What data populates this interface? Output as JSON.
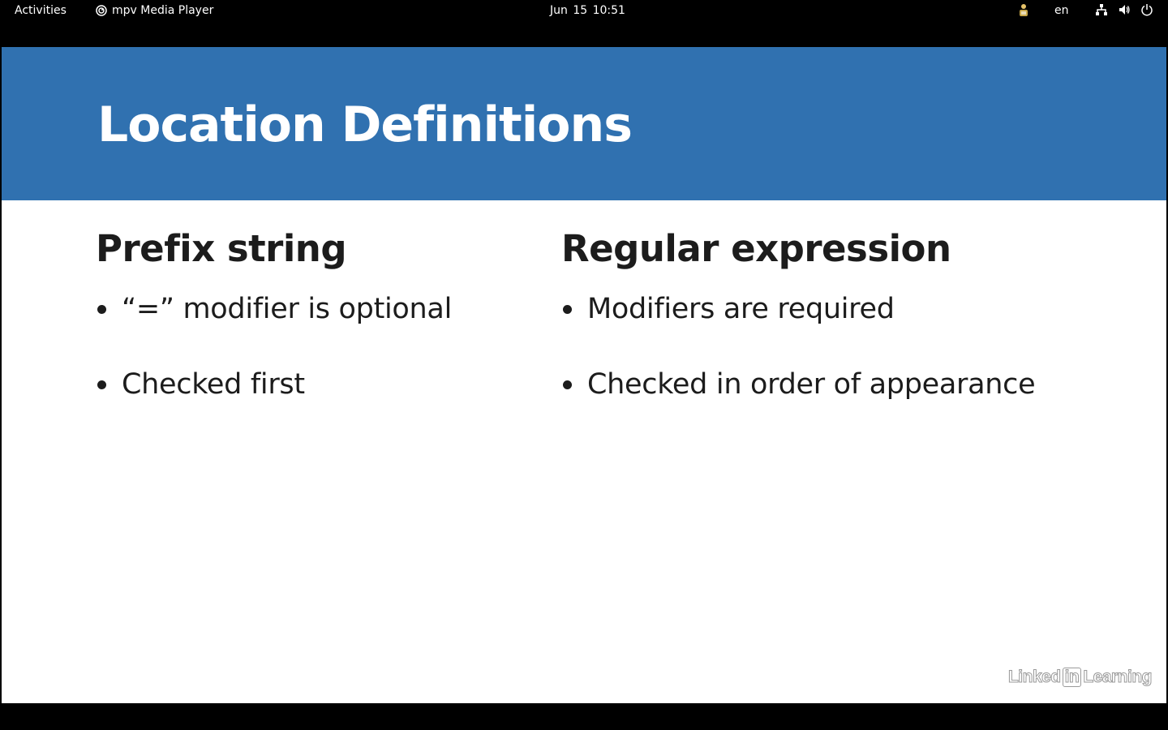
{
  "topbar": {
    "activities_label": "Activities",
    "app_name": "mpv Media Player",
    "clock": "Jun 15  10:51",
    "language": "en"
  },
  "slide": {
    "title": "Location Definitions",
    "header_color": "#3071b0",
    "columns": [
      {
        "heading": "Prefix string",
        "bullets": [
          "“=” modifier is optional",
          "Checked first"
        ]
      },
      {
        "heading": "Regular expression",
        "bullets": [
          "Modifiers are required",
          "Checked in order of appearance"
        ]
      }
    ],
    "watermark_linked": "Linked",
    "watermark_in": "in",
    "watermark_learning": "Learning"
  },
  "icons": {
    "app": "mpv-icon",
    "accessibility": "accessibility-icon",
    "network": "network-icon",
    "volume": "volume-icon",
    "power": "power-icon"
  }
}
